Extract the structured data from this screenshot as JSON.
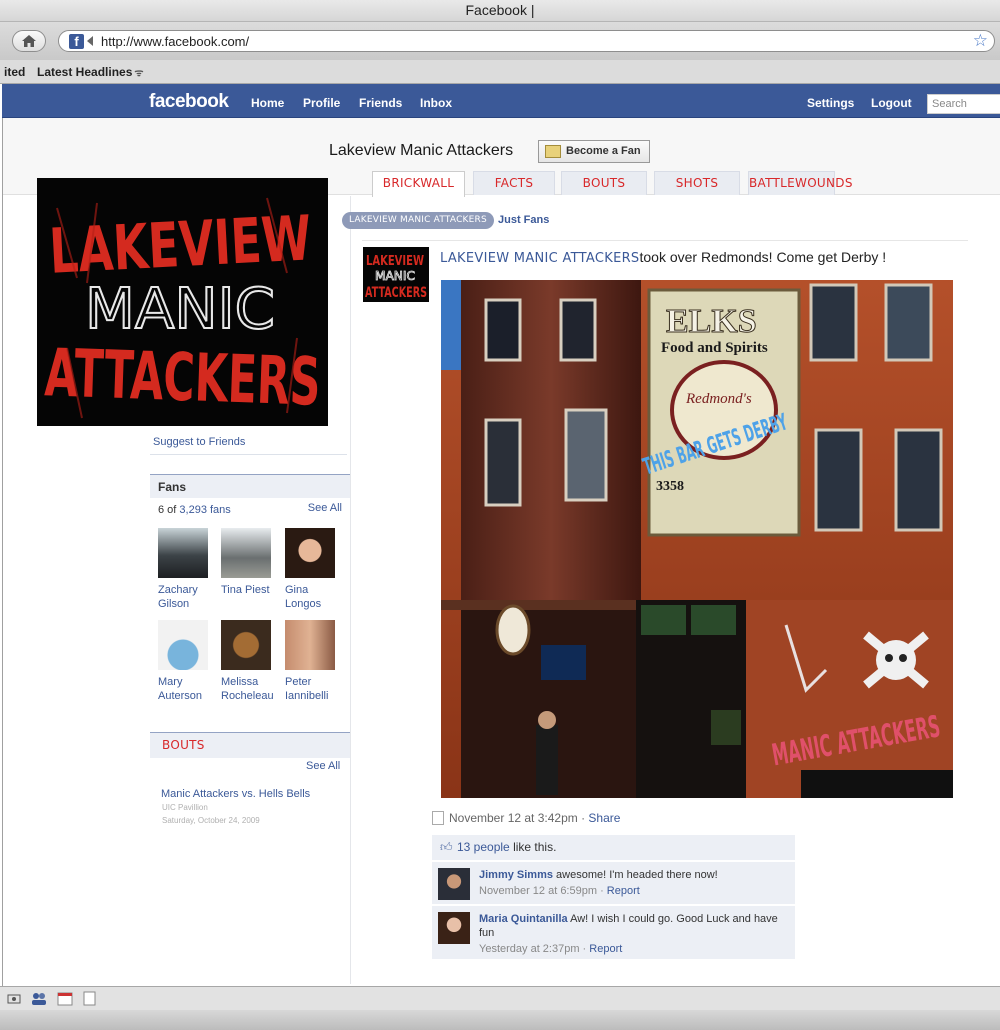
{
  "window": {
    "title": "Facebook |"
  },
  "browser": {
    "url": "http://www.facebook.com/",
    "bookmarks": [
      {
        "label": "ited"
      },
      {
        "label": "Latest Headlines"
      }
    ]
  },
  "fb_header": {
    "logo": "facebook",
    "nav": [
      "Home",
      "Profile",
      "Friends",
      "Inbox"
    ],
    "right_nav": [
      "Settings",
      "Logout"
    ],
    "search_placeholder": "Search"
  },
  "page": {
    "title": "Lakeview Manic Attackers",
    "become_fan_label": "Become a Fan",
    "tabs": [
      "BRICKWALL",
      "FACTS",
      "BOUTS",
      "SHOTS",
      "BATTLEWOUNDS"
    ],
    "active_tab": "BRICKWALL",
    "profile_logo_lines": [
      "LAKEVIEW",
      "MANIC",
      "ATTACKERS"
    ],
    "suggest_link": "Suggest to Friends"
  },
  "fans": {
    "heading": "Fans",
    "count_prefix": "6 of",
    "count_link": "3,293 fans",
    "see_all": "See All",
    "people": [
      {
        "first": "Zachary",
        "last": "Gilson"
      },
      {
        "first": "Tina Piest",
        "last": ""
      },
      {
        "first": "Gina",
        "last": "Longos"
      },
      {
        "first": "Mary",
        "last": "Auterson"
      },
      {
        "first": "Melissa",
        "last": "Rocheleau"
      },
      {
        "first": "Peter",
        "last": "Iannibelli"
      }
    ]
  },
  "bouts": {
    "heading": "BOUTS",
    "see_all": "See All",
    "event_title": "Manic Attackers vs. Hells Bells",
    "event_venue": "UIC Pavillion",
    "event_date": "Saturday, October 24, 2009"
  },
  "wall": {
    "filter_pill": "LAKEVIEW MANIC ATTACKERS",
    "filter_link": "Just Fans",
    "post": {
      "author": "LAKEVIEW MANIC ATTACKERS",
      "text": "took over Redmonds! Come get Derby !",
      "photo_sign": {
        "top": "ELKS",
        "sub": "Food and Spirits",
        "oval": "Redmond's",
        "graffiti": "THIS BAR GETS DERBY",
        "address": "3358"
      },
      "photo_graffiti": "MANIC ATTACKERS",
      "timestamp": "November 12 at 3:42pm",
      "share": "Share",
      "likes_link": "13 people",
      "likes_text": "like this."
    },
    "comments": [
      {
        "name": "Jimmy Simms",
        "text": "awesome! I'm headed there now!",
        "time": "November 12 at 6:59pm",
        "action": "Report"
      },
      {
        "name": "Maria Quintanilla",
        "text": "Aw! I wish I could go. Good Luck and have fun",
        "time": "Yesterday at 2:37pm",
        "action": "Report"
      }
    ]
  },
  "colors": {
    "fb_blue": "#3b5998",
    "tab_red": "#d8282a",
    "logo_red": "#d42a1f"
  },
  "icons": [
    "home-icon",
    "facebook-favicon",
    "bookmark-star-icon",
    "rss-icon",
    "thumbs-up-icon",
    "checkbox-icon",
    "statusbar-icons"
  ]
}
